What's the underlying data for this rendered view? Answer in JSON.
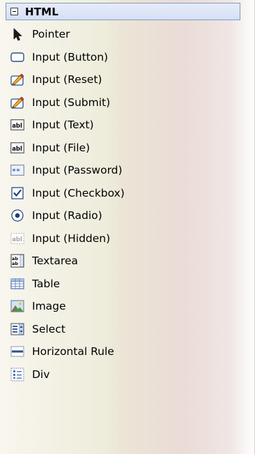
{
  "tab": {
    "title": "HTML",
    "expanded": true
  },
  "items": [
    {
      "label": "Pointer",
      "icon": "pointer-icon"
    },
    {
      "label": "Input (Button)",
      "icon": "button-icon"
    },
    {
      "label": "Input (Reset)",
      "icon": "reset-icon"
    },
    {
      "label": "Input (Submit)",
      "icon": "submit-icon"
    },
    {
      "label": "Input (Text)",
      "icon": "textbox-icon"
    },
    {
      "label": "Input (File)",
      "icon": "file-input-icon"
    },
    {
      "label": "Input (Password)",
      "icon": "password-icon"
    },
    {
      "label": "Input (Checkbox)",
      "icon": "checkbox-icon"
    },
    {
      "label": "Input (Radio)",
      "icon": "radio-icon"
    },
    {
      "label": "Input (Hidden)",
      "icon": "hidden-input-icon"
    },
    {
      "label": "Textarea",
      "icon": "textarea-icon"
    },
    {
      "label": "Table",
      "icon": "table-icon"
    },
    {
      "label": "Image",
      "icon": "image-icon"
    },
    {
      "label": "Select",
      "icon": "select-icon"
    },
    {
      "label": "Horizontal Rule",
      "icon": "horizontal-rule-icon"
    },
    {
      "label": "Div",
      "icon": "div-icon"
    }
  ],
  "colors": {
    "header_border": "#7f9db9",
    "header_fill": "#d6dff5",
    "icon_blue": "#2b5ea8"
  }
}
